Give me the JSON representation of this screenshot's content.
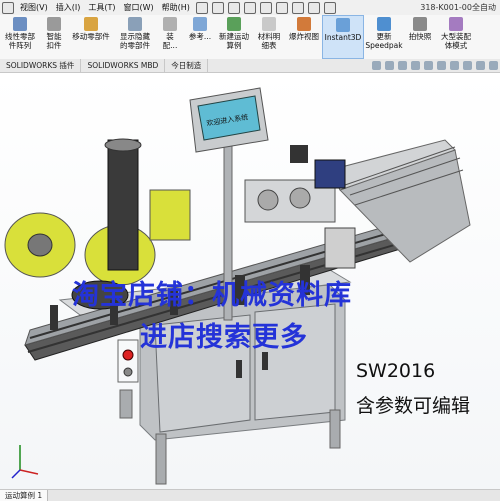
{
  "menubar": {
    "items": [
      "视图(V)",
      "插入(I)",
      "工具(T)",
      "窗口(W)",
      "帮助(H)"
    ],
    "doc_title": "318-K001-00全自动"
  },
  "ribbon": {
    "buttons": [
      {
        "label": "线性零部件阵列",
        "icon": "linear-pattern-icon"
      },
      {
        "label": "智能扣件",
        "icon": "smart-fasteners-icon"
      },
      {
        "label": "移动零部件",
        "icon": "move-component-icon"
      },
      {
        "label": "显示隐藏的零部件",
        "icon": "show-hidden-icon"
      },
      {
        "label": "装配...",
        "icon": "assembly-icon"
      },
      {
        "label": "参考...",
        "icon": "reference-icon"
      },
      {
        "label": "新建运动算例",
        "icon": "motion-study-icon"
      },
      {
        "label": "材料明细表",
        "icon": "bom-icon"
      },
      {
        "label": "爆炸视图",
        "icon": "exploded-view-icon"
      },
      {
        "label": "Instant3D",
        "icon": "instant3d-icon"
      },
      {
        "label": "更新Speedpak",
        "icon": "speedpak-icon"
      },
      {
        "label": "拍快照",
        "icon": "snapshot-icon"
      },
      {
        "label": "大型装配体模式",
        "icon": "large-assembly-icon"
      }
    ],
    "active": "Instant3D"
  },
  "tabs": [
    "SOLIDWORKS 插件",
    "SOLIDWORKS MBD",
    "今日制造"
  ],
  "viewport": {
    "hmi_screen_text": "欢迎进入系统",
    "watermark_line1": "淘宝店铺：机械资料库",
    "watermark_line2": "进店搜索更多",
    "note_line1": "SW2016",
    "note_line2": "含参数可编辑"
  },
  "statusbar": {
    "tab": "运动算例 1"
  },
  "colors": {
    "frame": "#c7c9cc",
    "conveyor": "#4d4d4d",
    "accent_green": "#d9e03a",
    "dark_body": "#2a2a2a",
    "watermark": "#2433d8",
    "active_button": "#cfe3f8"
  }
}
